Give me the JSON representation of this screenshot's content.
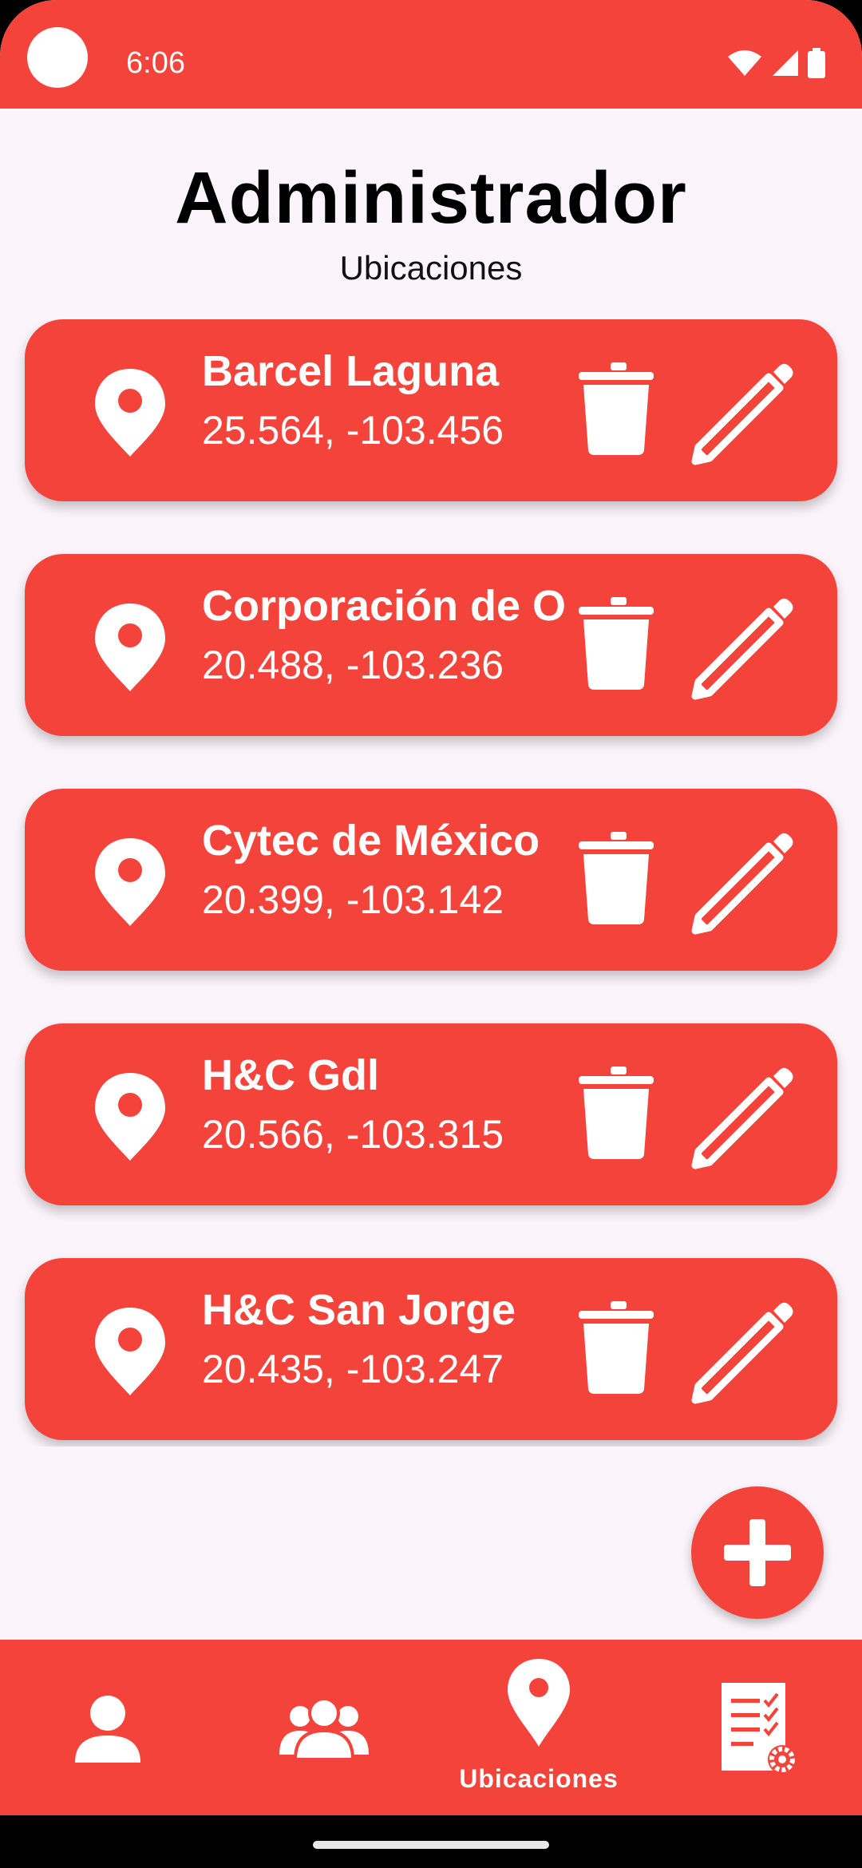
{
  "status_bar": {
    "time": "6:06",
    "icons": [
      "camera-dot",
      "wifi-icon",
      "signal-icon",
      "battery-icon"
    ]
  },
  "header": {
    "title": "Administrador",
    "subtitle": "Ubicaciones"
  },
  "locations": [
    {
      "name": "Barcel Laguna",
      "coords": "25.564, -103.456"
    },
    {
      "name": "Corporación de O",
      "coords": "20.488, -103.236"
    },
    {
      "name": "Cytec de México",
      "coords": "20.399, -103.142"
    },
    {
      "name": "H&C Gdl",
      "coords": "20.566, -103.315"
    },
    {
      "name": "H&C San Jorge",
      "coords": "20.435, -103.247"
    }
  ],
  "card_icons": {
    "left": "map-pin-icon",
    "delete": "trash-icon",
    "edit": "pencil-icon"
  },
  "fab": {
    "icon": "plus-icon"
  },
  "bottom_nav": {
    "items": [
      {
        "icon": "person-icon",
        "label": ""
      },
      {
        "icon": "group-icon",
        "label": ""
      },
      {
        "icon": "map-pin-icon",
        "label": "Ubicaciones",
        "active": true
      },
      {
        "icon": "report-settings-icon",
        "label": ""
      }
    ]
  },
  "colors": {
    "accent": "#f4433a",
    "background": "#fbf5fb",
    "on_accent": "#ffffff"
  }
}
